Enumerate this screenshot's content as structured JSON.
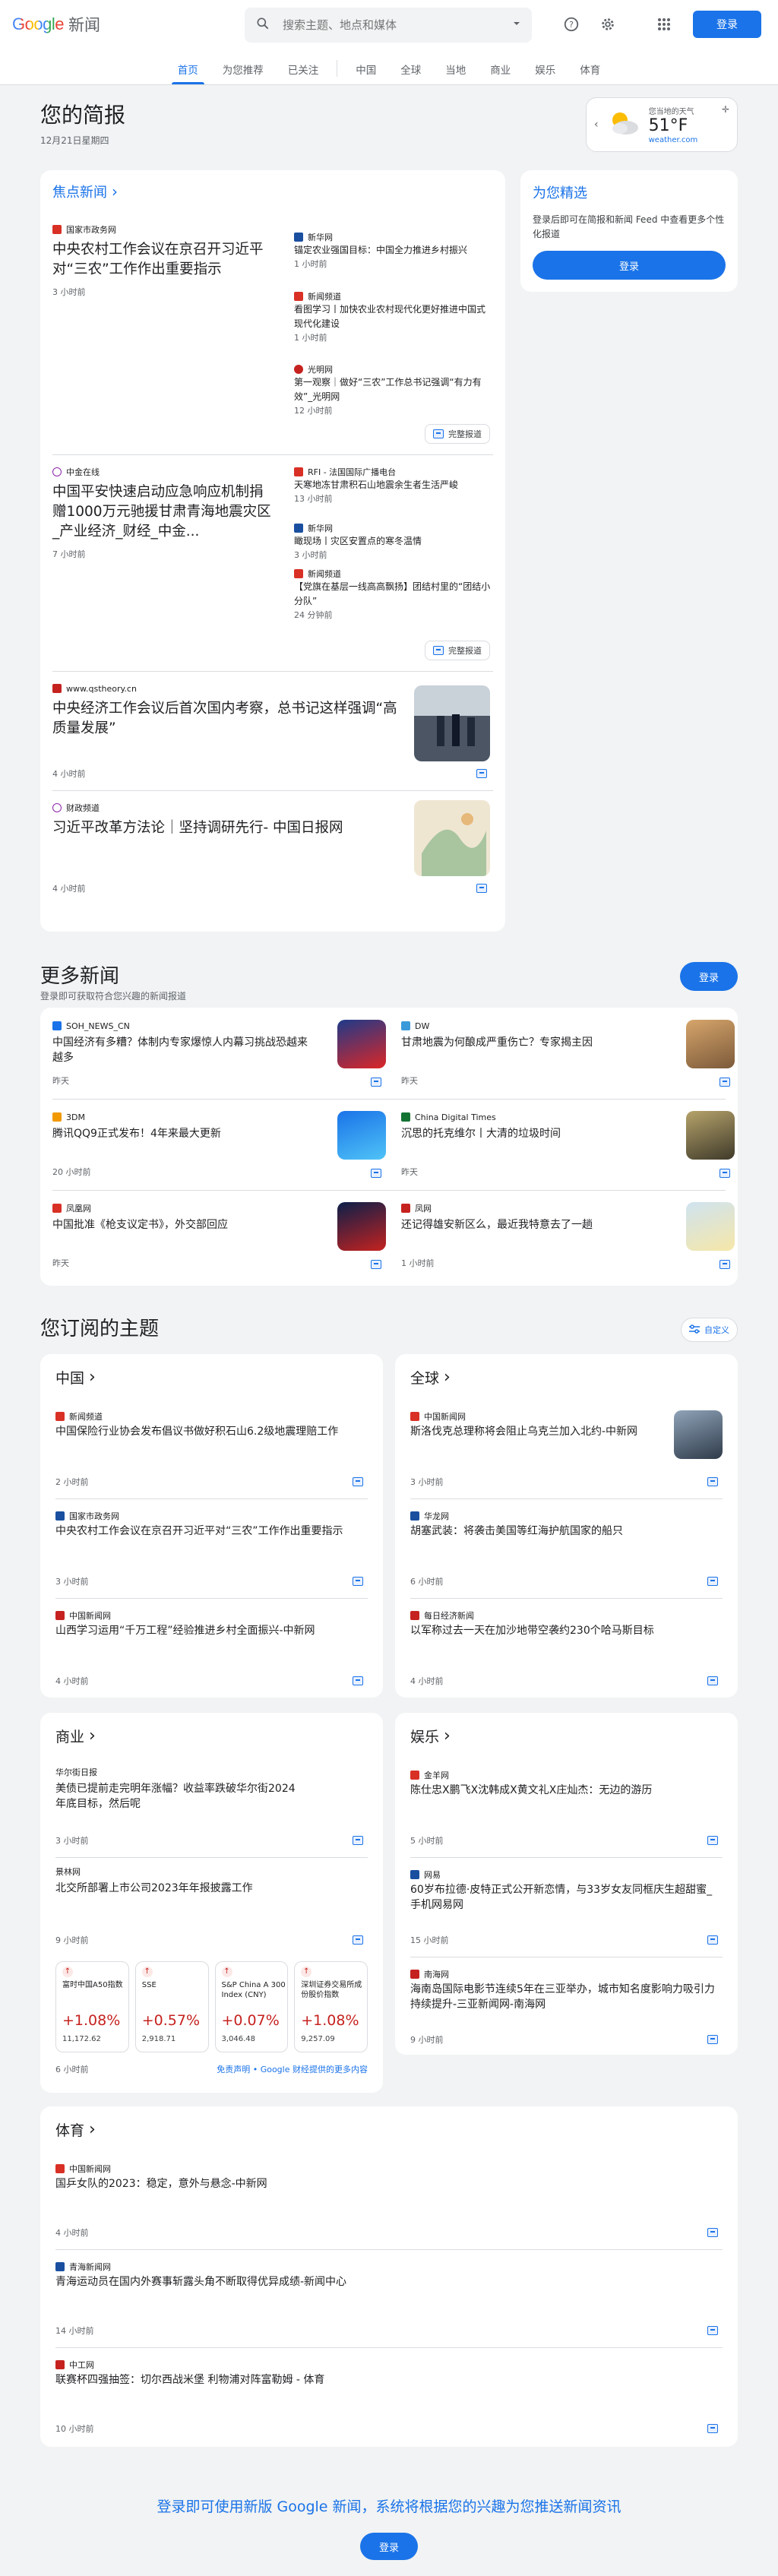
{
  "header": {
    "logo_google": "Google",
    "logo_news": "新闻",
    "search_placeholder": "搜索主题、地点和媒体",
    "signin": "登录"
  },
  "nav": {
    "tabs": [
      "首页",
      "为您推荐",
      "已关注",
      "中国",
      "全球",
      "当地",
      "商业",
      "娱乐",
      "体育"
    ],
    "active": "首页"
  },
  "brief": {
    "title": "您的简报",
    "date": "12月21日星期四"
  },
  "weather": {
    "label": "您当地的天气",
    "temp": "51°F",
    "source": "weather.com"
  },
  "colors": {
    "accent": "#1a73e8",
    "up_red": "#c5221f"
  },
  "headlines": {
    "title": "焦点新闻",
    "clusters": [
      {
        "main": {
          "source": "国家市政务网",
          "title": "中央农村工作会议在京召开习近平对“三农”工作作出重要指示",
          "time": "3 小时前"
        },
        "side": [
          {
            "source": "新华网",
            "title": "锚定农业强国目标：中国全力推进乡村振兴",
            "time": "1 小时前"
          },
          {
            "source": "新闻频道",
            "title": "看图学习丨加快农业农村现代化更好推进中国式现代化建设",
            "time": "1 小时前"
          },
          {
            "source": "光明网",
            "title": "第一观察｜做好“三农”工作总书记强调“有力有效”_光明网",
            "time": "12 小时前"
          }
        ],
        "coverage": "完整报道"
      },
      {
        "main": {
          "source": "中金在线",
          "title": "中国平安快速启动应急响应机制捐赠1000万元驰援甘肃青海地震灾区_产业经济_财经_中金...",
          "time": "7 小时前"
        },
        "side": [
          {
            "source": "RFI - 法国国际广播电台",
            "title": "天寒地冻甘肃积石山地震余生者生活严峻",
            "time": "13 小时前"
          },
          {
            "source": "新华网",
            "title": "瞰现场丨灾区安置点的寒冬温情",
            "time": "3 小时前"
          },
          {
            "source": "新闻频道",
            "title": "【党旗在基层一线高高飘扬】团结村里的“团结小分队”",
            "time": "24 分钟前"
          }
        ],
        "coverage": "完整报道"
      }
    ],
    "singles": [
      {
        "source": "www.qstheory.cn",
        "title": "中央经济工作会议后首次国内考察，总书记这样强调“高质量发展”",
        "time": "4 小时前"
      },
      {
        "source": "财政频道",
        "title": "习近平改革方法论｜坚持调研先行- 中国日报网",
        "time": "4 小时前"
      }
    ]
  },
  "picks": {
    "title": "为您精选",
    "desc": "登录后即可在简报和新闻 Feed 中查看更多个性化报道",
    "button": "登录"
  },
  "more": {
    "title": "更多新闻",
    "subtitle": "登录即可获取符合您兴趣的新闻报道",
    "button": "登录",
    "items": [
      {
        "source": "SOH_NEWS_CN",
        "title": "中国经济有多糟？体制内专家爆惊人内幕习挑战恐越来越多",
        "time": "昨天"
      },
      {
        "source": "DW",
        "title": "甘肃地震为何酿成严重伤亡？专家揭主因",
        "time": "昨天"
      },
      {
        "source": "3DM",
        "title": "腾讯QQ9正式发布！4年来最大更新",
        "time": "20 小时前"
      },
      {
        "source": "China Digital Times",
        "title": "沉思的托克维尔丨大清的垃圾时间",
        "time": "昨天"
      },
      {
        "source": "凤凰网",
        "title": "中国批准《枪支议定书》，外交部回应",
        "time": "昨天"
      },
      {
        "source": "凤网",
        "title": "还记得雄安新区么，最近我特意去了一趟",
        "time": "1 小时前"
      }
    ]
  },
  "topics": {
    "title": "您订阅的主题",
    "customize": "自定义",
    "china": {
      "title": "中国",
      "items": [
        {
          "source": "新闻频道",
          "title": "中国保险行业协会发布倡议书做好积石山6.2级地震理赔工作",
          "time": "2 小时前"
        },
        {
          "source": "国家市政务网",
          "title": "中央农村工作会议在京召开习近平对“三农”工作作出重要指示",
          "time": "3 小时前"
        },
        {
          "source": "中国新闻网",
          "title": "山西学习运用“千万工程”经验推进乡村全面振兴-中新网",
          "time": "4 小时前"
        }
      ]
    },
    "world": {
      "title": "全球",
      "items": [
        {
          "source": "中国新闻网",
          "title": "斯洛伐克总理称将会阻止乌克兰加入北约-中新网",
          "time": "3 小时前"
        },
        {
          "source": "华龙网",
          "title": "胡塞武装：将袭击美国等红海护航国家的船只",
          "time": "6 小时前"
        },
        {
          "source": "每日经济新闻",
          "title": "以军称过去一天在加沙地带空袭约230个哈马斯目标",
          "time": "4 小时前"
        }
      ]
    },
    "business": {
      "title": "商业",
      "items": [
        {
          "source": "华尔街日报",
          "title": "美债已提前走完明年涨幅？收益率跌破华尔街2024年底目标，然后呢",
          "time": "3 小时前"
        },
        {
          "source": "景林网",
          "title": "北交所部署上市公司2023年年报披露工作",
          "time": "9 小时前"
        }
      ],
      "stocks": [
        {
          "name": "富时中国A50指数",
          "pct": "+1.08%",
          "value": "11,172.62"
        },
        {
          "name": "SSE",
          "pct": "+0.57%",
          "value": "2,918.71"
        },
        {
          "name": "S&P China A 300 Index (CNY)",
          "pct": "+0.07%",
          "value": "3,046.48"
        },
        {
          "name": "深圳证券交易所成份股价指数",
          "pct": "+1.08%",
          "value": "9,257.09"
        }
      ],
      "stocks_time": "6 小时前",
      "disclaimer": "免责声明 • Google 财经提供的更多内容"
    },
    "ent": {
      "title": "娱乐",
      "items": [
        {
          "source": "金羊网",
          "title": "陈仕忠X鹏飞X沈韩成X黄文礼X庄灿杰：无边的游历",
          "time": "5 小时前"
        },
        {
          "source": "网易",
          "title": "60岁布拉德·皮特正式公开新恋情，与33岁女友同框庆生超甜蜜_手机网易网",
          "time": "15 小时前"
        },
        {
          "source": "南海网",
          "title": "海南岛国际电影节连续5年在三亚举办，城市知名度影响力吸引力持续提升-三亚新闻网-南海网",
          "time": "9 小时前"
        }
      ]
    },
    "sports": {
      "title": "体育",
      "items": [
        {
          "source": "中国新闻网",
          "title": "国乒女队的2023：稳定，意外与悬念-中新网",
          "time": "4 小时前"
        },
        {
          "source": "青海新闻网",
          "title": "青海运动员在国内外赛事斩露头角不断取得优异成绩-新闻中心",
          "time": "14 小时前"
        },
        {
          "source": "中工网",
          "title": "联赛杯四强抽签：切尔西战米堡 利物浦对阵富勒姆 - 体育",
          "time": "10 小时前"
        }
      ]
    }
  },
  "footer": {
    "text": "登录即可使用新版 Google 新闻，系统将根据您的兴趣为您推送新闻资讯",
    "button": "登录"
  }
}
